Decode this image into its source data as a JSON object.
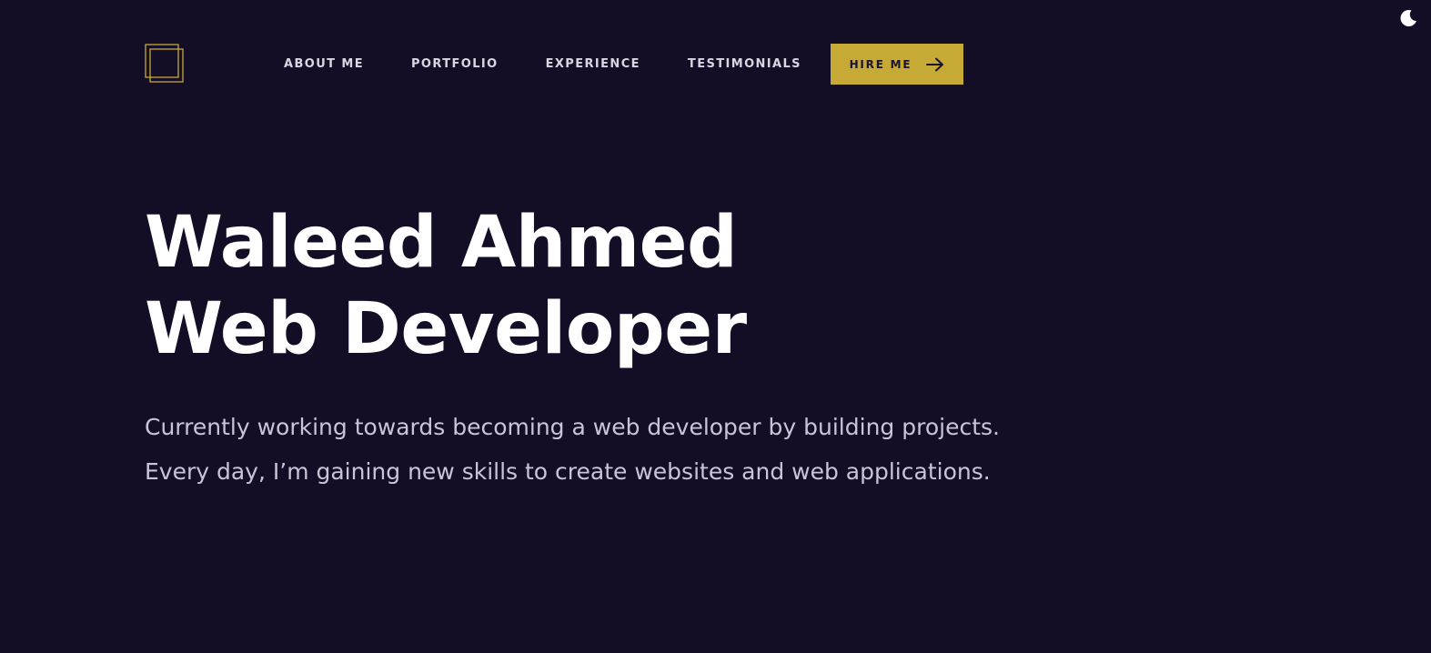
{
  "theme": {
    "background": "#140d26",
    "accent": "#c7a936",
    "toggle_icon": "moon-icon"
  },
  "header": {
    "logo_icon": "double-square-logo-icon",
    "nav": [
      {
        "label": "ABOUT ME"
      },
      {
        "label": "PORTFOLIO"
      },
      {
        "label": "EXPERIENCE"
      },
      {
        "label": "TESTIMONIALS"
      }
    ],
    "cta": {
      "label": "HIRE ME",
      "icon": "arrow-right-icon"
    }
  },
  "hero": {
    "title_line1": "Waleed Ahmed",
    "title_line2": "Web Developer",
    "desc_line1": "Currently working towards becoming a web developer by building projects.",
    "desc_line2": "Every day, I’m gaining new skills to create websites and web applications."
  }
}
